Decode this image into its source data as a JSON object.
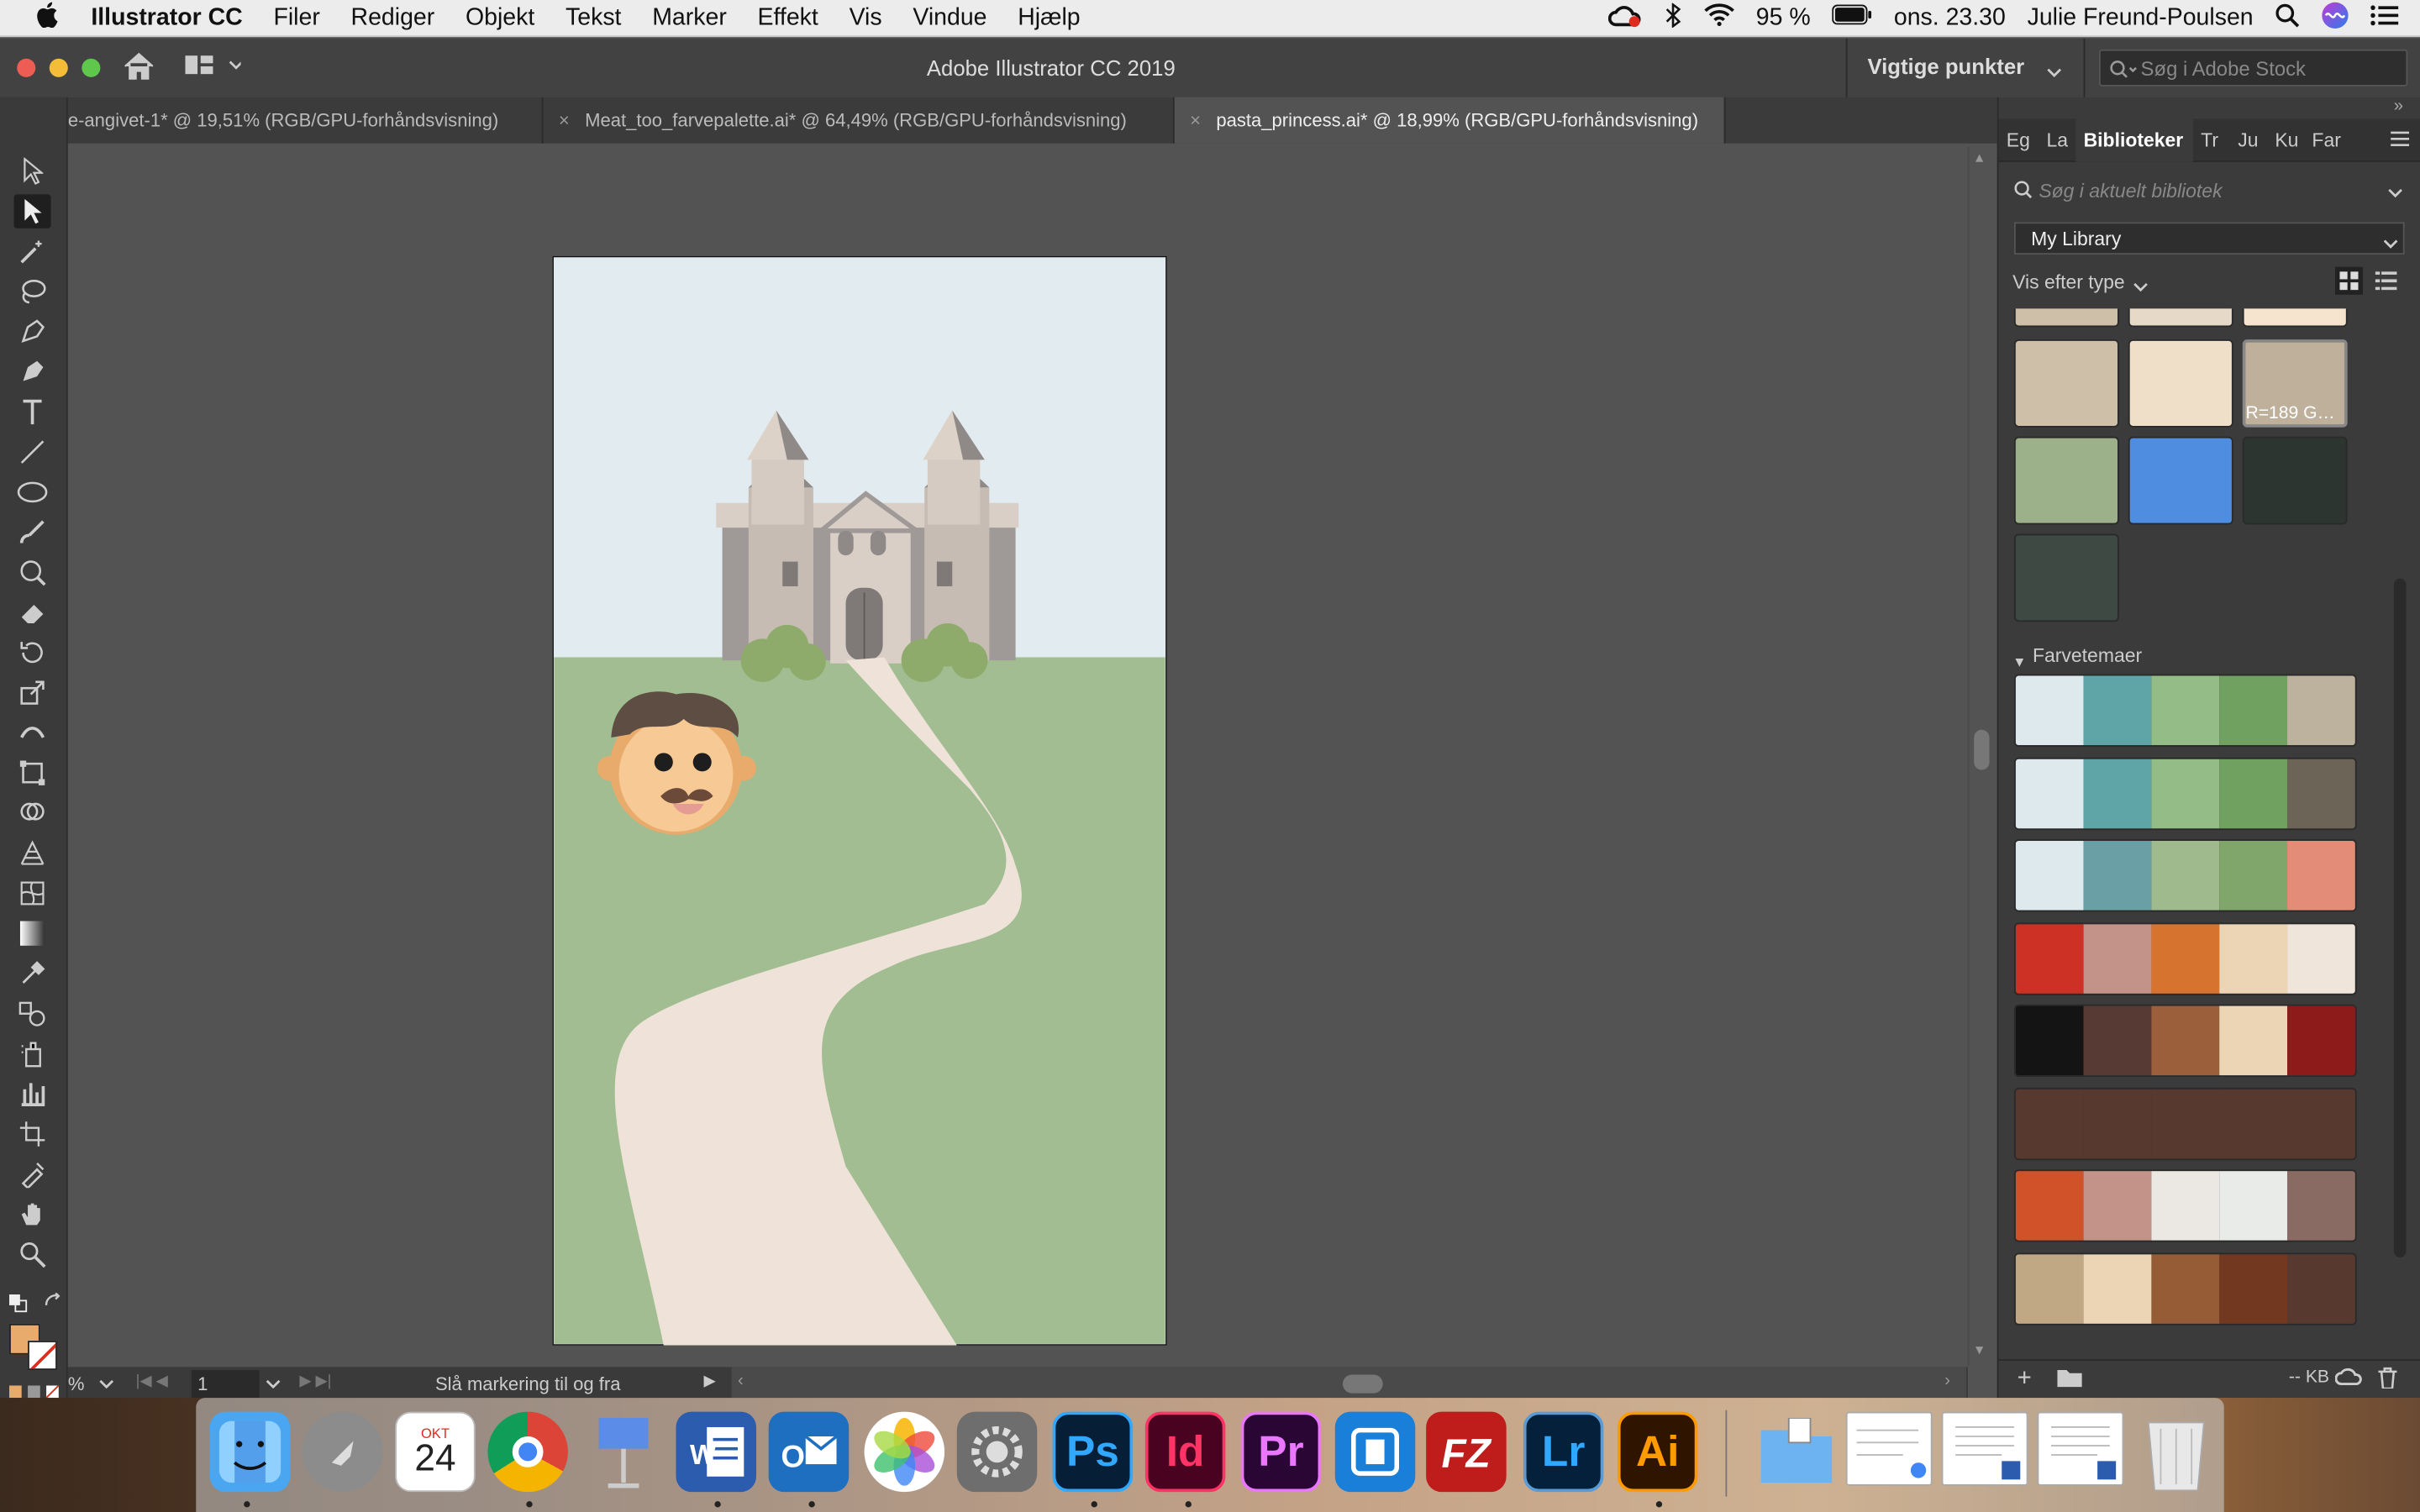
{
  "menubar": {
    "app": "Illustrator CC",
    "items": [
      "Filer",
      "Rediger",
      "Objekt",
      "Tekst",
      "Marker",
      "Effekt",
      "Vis",
      "Vindue",
      "Hjælp"
    ],
    "battery": "95 %",
    "clock": "ons. 23.30",
    "user": "Julie Freund-Poulsen"
  },
  "titlebar": {
    "title": "Adobe Illustrator CC 2019",
    "workspace": "Vigtige punkter",
    "stock_placeholder": "Søg i Adobe Stock"
  },
  "doc_tabs": [
    {
      "label": "e-angivet-1* @ 19,51% (RGB/GPU-forhåndsvisning)",
      "close": ""
    },
    {
      "label": "Meat_too_farvepalette.ai* @ 64,49% (RGB/GPU-forhåndsvisning)",
      "close": "×"
    },
    {
      "label": "pasta_princess.ai* @ 18,99% (RGB/GPU-forhåndsvisning)",
      "close": "×"
    }
  ],
  "panel": {
    "tabs": [
      "Eg",
      "La",
      "Biblioteker",
      "Tr",
      "Ju",
      "Ku",
      "Far"
    ],
    "search_placeholder": "Søg i aktuelt bibliotek",
    "library": "My Library",
    "view_by": "Vis efter type",
    "swatch_tooltip": "R=189 G…",
    "themes_heading": "Farvetemaer",
    "footer_kb": "-- KB",
    "swatch_colors": [
      "#cdbfa8",
      "#f0dfc8",
      "#bfb09b",
      "#9cb08a",
      "#4e8de0",
      "#2c3530",
      "#3f4944"
    ],
    "themes": [
      [
        "#dde9ec",
        "#5fa5a8",
        "#93bc86",
        "#70a161",
        "#bdb29d"
      ],
      [
        "#dde9ec",
        "#5fa5a8",
        "#93bc86",
        "#70a161",
        "#6d6458"
      ],
      [
        "#dde9ec",
        "#6a9fa6",
        "#9fbb8e",
        "#80a66b",
        "#e38d78"
      ],
      [
        "#cd3024",
        "#c3938a",
        "#d6742f",
        "#ecd5b5",
        "#f0e5db"
      ],
      [
        "#141414",
        "#573a33",
        "#9b5f3c",
        "#ecd5b5",
        "#8c1b1a"
      ],
      [
        "#57392f",
        "#57392f",
        "#57392f",
        "#57392f",
        "#57392f"
      ],
      [
        "#d15128",
        "#c3938a",
        "#ebe7e2",
        "#e9ebe8",
        "#8a6b63"
      ],
      [
        "#bfa883",
        "#ecd5b5",
        "#955c36",
        "#733820",
        "#57392f"
      ]
    ]
  },
  "status": {
    "zoom": "%",
    "page": "1",
    "message": "Slå markering til og fra"
  },
  "dock": {
    "calendar_month": "OKT",
    "calendar_day": "24",
    "apps": [
      "Ps",
      "Id",
      "Pr",
      "Lr",
      "Ai"
    ]
  }
}
